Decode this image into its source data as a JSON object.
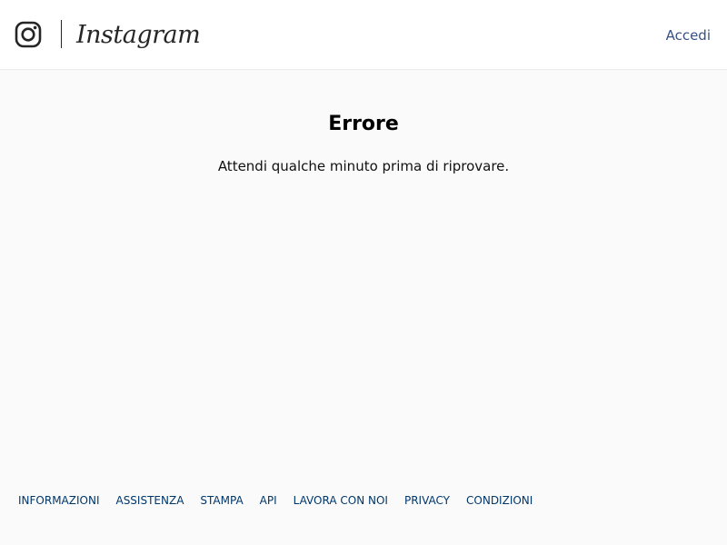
{
  "header": {
    "brand_name": "Instagram",
    "login_label": "Accedi",
    "logo_icon": "instagram-camera-icon"
  },
  "main": {
    "title": "Errore",
    "message": "Attendi qualche minuto prima di riprovare."
  },
  "footer": {
    "links": [
      {
        "label": "INFORMAZIONI"
      },
      {
        "label": "ASSISTENZA"
      },
      {
        "label": "STAMPA"
      },
      {
        "label": "API"
      },
      {
        "label": "LAVORA CON NOI"
      },
      {
        "label": "PRIVACY"
      },
      {
        "label": "CONDIZIONI"
      }
    ]
  },
  "colors": {
    "background": "#fafafa",
    "header_background": "#ffffff",
    "link_blue": "#385185",
    "footer_link": "#00376b",
    "text": "#262626"
  }
}
